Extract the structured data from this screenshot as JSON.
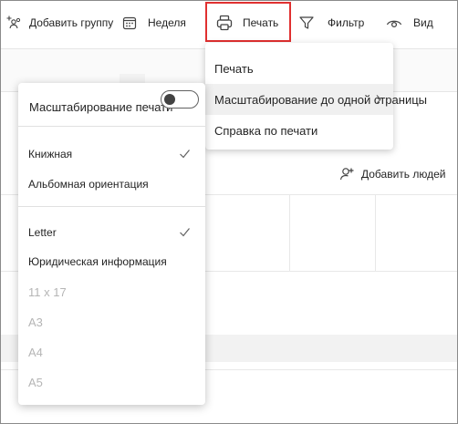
{
  "toolbar": {
    "add_group": "Добавить группу",
    "week": "Неделя",
    "print": "Печать",
    "filter": "Фильтр",
    "view": "Вид"
  },
  "add_people": "Добавить людей",
  "print_menu": {
    "items": [
      {
        "label": "Печать"
      },
      {
        "label": "Масштабирование до одной страницы"
      },
      {
        "label": "Справка по печати"
      }
    ]
  },
  "scale_menu": {
    "toggle_label": "Масштабирование печати",
    "toggle_on": false,
    "orientation": [
      {
        "label": "Книжная",
        "checked": true
      },
      {
        "label": "Альбомная ориентация",
        "checked": false
      }
    ],
    "paper_sizes": [
      {
        "label": "Letter",
        "checked": true,
        "enabled": true
      },
      {
        "label": "Юридическая информация",
        "checked": false,
        "enabled": true
      },
      {
        "label": "11 x 17",
        "checked": false,
        "enabled": false
      },
      {
        "label": "A3",
        "checked": false,
        "enabled": false
      },
      {
        "label": "A4",
        "checked": false,
        "enabled": false
      },
      {
        "label": "A5",
        "checked": false,
        "enabled": false
      }
    ]
  },
  "colors": {
    "highlight_border": "#e03030",
    "text": "#242424",
    "disabled_text": "#b5b5b5"
  }
}
